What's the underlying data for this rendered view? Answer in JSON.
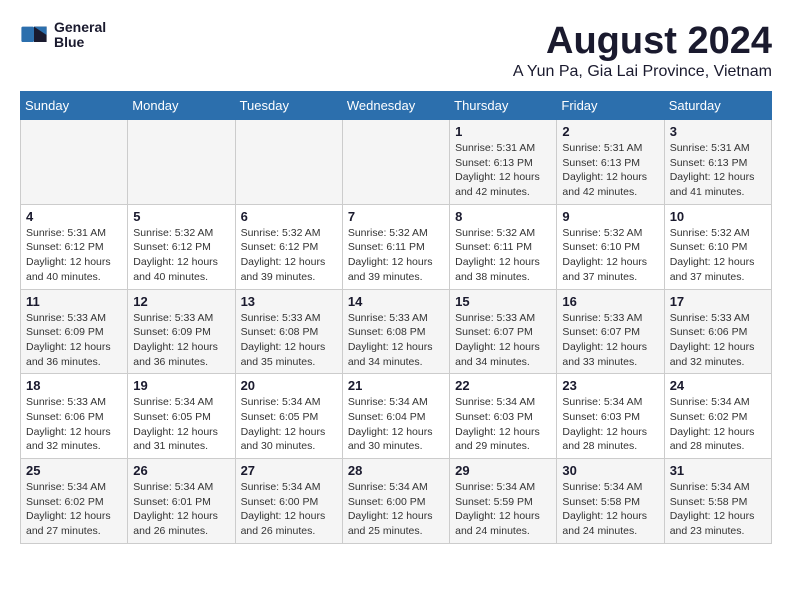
{
  "logo": {
    "text_line1": "General",
    "text_line2": "Blue"
  },
  "title": "August 2024",
  "subtitle": "A Yun Pa, Gia Lai Province, Vietnam",
  "days_of_week": [
    "Sunday",
    "Monday",
    "Tuesday",
    "Wednesday",
    "Thursday",
    "Friday",
    "Saturday"
  ],
  "weeks": [
    [
      {
        "day": "",
        "content": ""
      },
      {
        "day": "",
        "content": ""
      },
      {
        "day": "",
        "content": ""
      },
      {
        "day": "",
        "content": ""
      },
      {
        "day": "1",
        "content": "Sunrise: 5:31 AM\nSunset: 6:13 PM\nDaylight: 12 hours\nand 42 minutes."
      },
      {
        "day": "2",
        "content": "Sunrise: 5:31 AM\nSunset: 6:13 PM\nDaylight: 12 hours\nand 42 minutes."
      },
      {
        "day": "3",
        "content": "Sunrise: 5:31 AM\nSunset: 6:13 PM\nDaylight: 12 hours\nand 41 minutes."
      }
    ],
    [
      {
        "day": "4",
        "content": "Sunrise: 5:31 AM\nSunset: 6:12 PM\nDaylight: 12 hours\nand 40 minutes."
      },
      {
        "day": "5",
        "content": "Sunrise: 5:32 AM\nSunset: 6:12 PM\nDaylight: 12 hours\nand 40 minutes."
      },
      {
        "day": "6",
        "content": "Sunrise: 5:32 AM\nSunset: 6:12 PM\nDaylight: 12 hours\nand 39 minutes."
      },
      {
        "day": "7",
        "content": "Sunrise: 5:32 AM\nSunset: 6:11 PM\nDaylight: 12 hours\nand 39 minutes."
      },
      {
        "day": "8",
        "content": "Sunrise: 5:32 AM\nSunset: 6:11 PM\nDaylight: 12 hours\nand 38 minutes."
      },
      {
        "day": "9",
        "content": "Sunrise: 5:32 AM\nSunset: 6:10 PM\nDaylight: 12 hours\nand 37 minutes."
      },
      {
        "day": "10",
        "content": "Sunrise: 5:32 AM\nSunset: 6:10 PM\nDaylight: 12 hours\nand 37 minutes."
      }
    ],
    [
      {
        "day": "11",
        "content": "Sunrise: 5:33 AM\nSunset: 6:09 PM\nDaylight: 12 hours\nand 36 minutes."
      },
      {
        "day": "12",
        "content": "Sunrise: 5:33 AM\nSunset: 6:09 PM\nDaylight: 12 hours\nand 36 minutes."
      },
      {
        "day": "13",
        "content": "Sunrise: 5:33 AM\nSunset: 6:08 PM\nDaylight: 12 hours\nand 35 minutes."
      },
      {
        "day": "14",
        "content": "Sunrise: 5:33 AM\nSunset: 6:08 PM\nDaylight: 12 hours\nand 34 minutes."
      },
      {
        "day": "15",
        "content": "Sunrise: 5:33 AM\nSunset: 6:07 PM\nDaylight: 12 hours\nand 34 minutes."
      },
      {
        "day": "16",
        "content": "Sunrise: 5:33 AM\nSunset: 6:07 PM\nDaylight: 12 hours\nand 33 minutes."
      },
      {
        "day": "17",
        "content": "Sunrise: 5:33 AM\nSunset: 6:06 PM\nDaylight: 12 hours\nand 32 minutes."
      }
    ],
    [
      {
        "day": "18",
        "content": "Sunrise: 5:33 AM\nSunset: 6:06 PM\nDaylight: 12 hours\nand 32 minutes."
      },
      {
        "day": "19",
        "content": "Sunrise: 5:34 AM\nSunset: 6:05 PM\nDaylight: 12 hours\nand 31 minutes."
      },
      {
        "day": "20",
        "content": "Sunrise: 5:34 AM\nSunset: 6:05 PM\nDaylight: 12 hours\nand 30 minutes."
      },
      {
        "day": "21",
        "content": "Sunrise: 5:34 AM\nSunset: 6:04 PM\nDaylight: 12 hours\nand 30 minutes."
      },
      {
        "day": "22",
        "content": "Sunrise: 5:34 AM\nSunset: 6:03 PM\nDaylight: 12 hours\nand 29 minutes."
      },
      {
        "day": "23",
        "content": "Sunrise: 5:34 AM\nSunset: 6:03 PM\nDaylight: 12 hours\nand 28 minutes."
      },
      {
        "day": "24",
        "content": "Sunrise: 5:34 AM\nSunset: 6:02 PM\nDaylight: 12 hours\nand 28 minutes."
      }
    ],
    [
      {
        "day": "25",
        "content": "Sunrise: 5:34 AM\nSunset: 6:02 PM\nDaylight: 12 hours\nand 27 minutes."
      },
      {
        "day": "26",
        "content": "Sunrise: 5:34 AM\nSunset: 6:01 PM\nDaylight: 12 hours\nand 26 minutes."
      },
      {
        "day": "27",
        "content": "Sunrise: 5:34 AM\nSunset: 6:00 PM\nDaylight: 12 hours\nand 26 minutes."
      },
      {
        "day": "28",
        "content": "Sunrise: 5:34 AM\nSunset: 6:00 PM\nDaylight: 12 hours\nand 25 minutes."
      },
      {
        "day": "29",
        "content": "Sunrise: 5:34 AM\nSunset: 5:59 PM\nDaylight: 12 hours\nand 24 minutes."
      },
      {
        "day": "30",
        "content": "Sunrise: 5:34 AM\nSunset: 5:58 PM\nDaylight: 12 hours\nand 24 minutes."
      },
      {
        "day": "31",
        "content": "Sunrise: 5:34 AM\nSunset: 5:58 PM\nDaylight: 12 hours\nand 23 minutes."
      }
    ]
  ]
}
